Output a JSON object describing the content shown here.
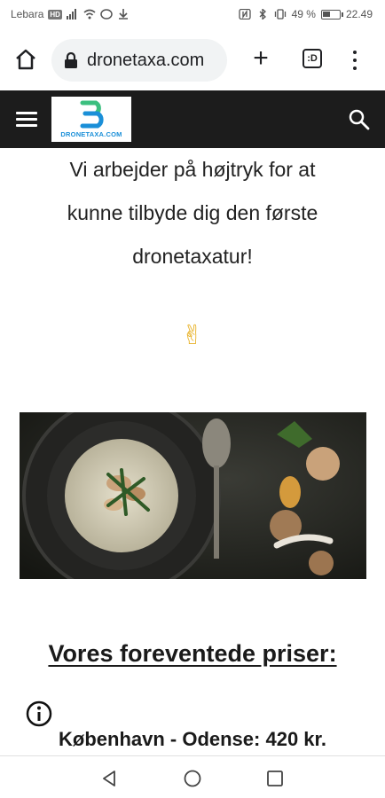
{
  "status_bar": {
    "carrier": "Lebara",
    "network_chip": "HD",
    "battery_percent": "49 %",
    "battery_level": 0.49,
    "time": "22.49"
  },
  "browser": {
    "url": "dronetaxa.com",
    "tab_count": ":D"
  },
  "site": {
    "logo_letter": "B",
    "logo_text": "DRONETAXA.COM"
  },
  "content": {
    "hero_line1": "Vi arbejder på højtryk for at",
    "hero_line2": "kunne tilbyde dig den første",
    "hero_line3": "dronetaxatur!",
    "emoji": "✌",
    "prices_heading": "Vores foreventede priser:",
    "price_line": "København - Odense: 420 kr."
  },
  "colors": {
    "header_bg": "#1c1c1c",
    "logo_green": "#3bbf7f",
    "logo_blue": "#1a8fd8"
  }
}
